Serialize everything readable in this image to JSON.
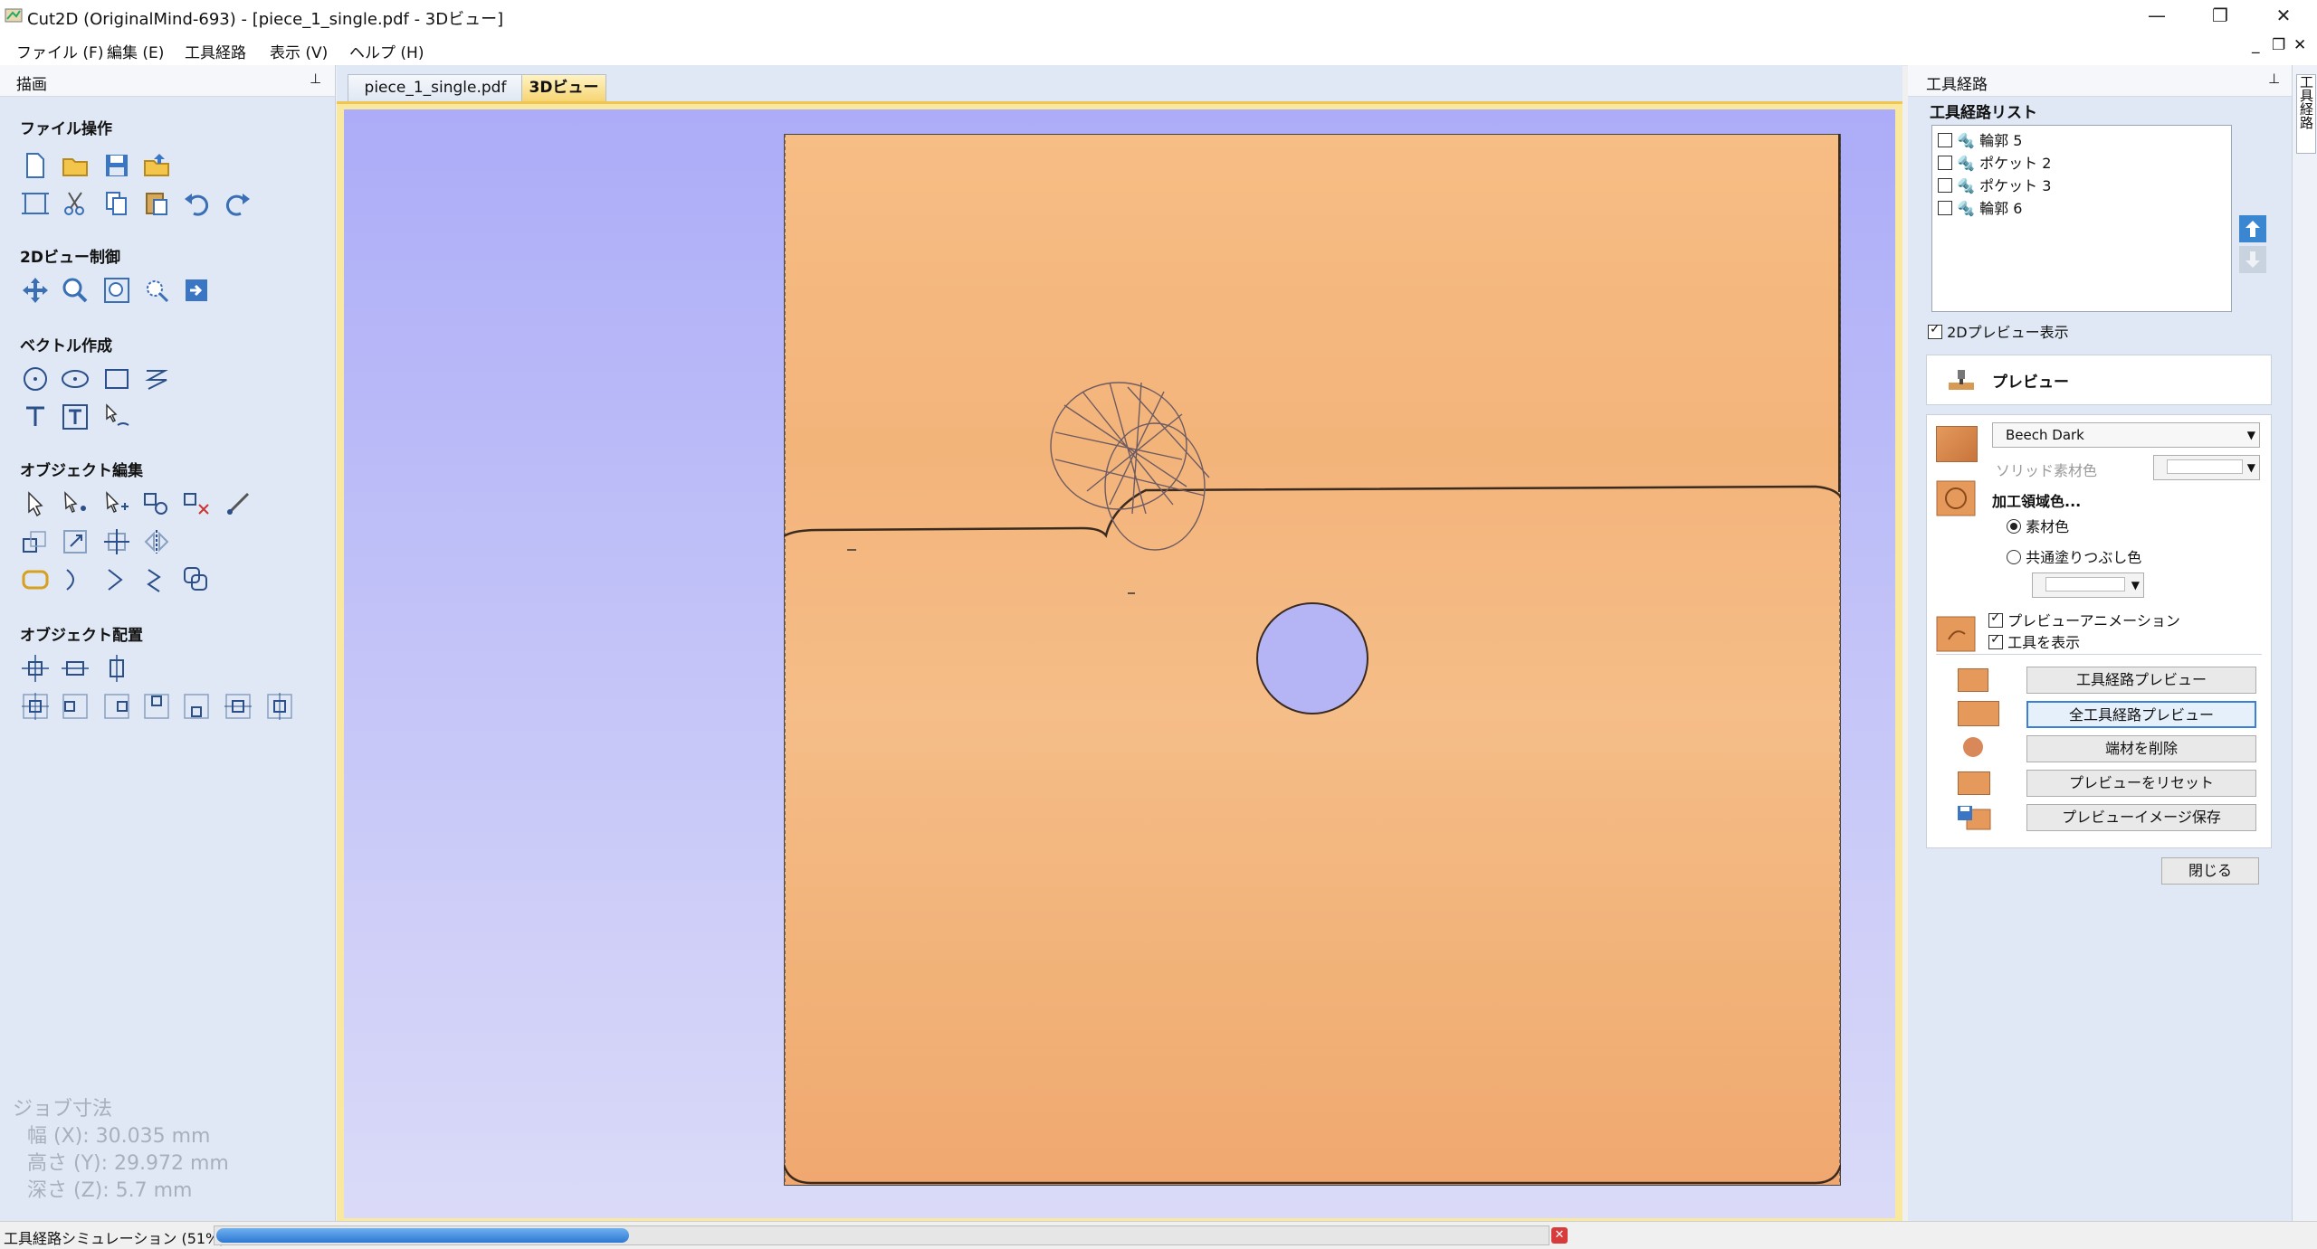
{
  "window": {
    "title": "Cut2D (OriginalMind-693) - [piece_1_single.pdf - 3Dビュー]",
    "min": "—",
    "restore": "❐",
    "close": "✕"
  },
  "menu": [
    "ファイル (F)",
    "編集 (E)",
    "工具経路",
    "表示 (V)",
    "ヘルプ (H)"
  ],
  "mdi": {
    "min": "_",
    "restore": "❐",
    "close": "✕"
  },
  "left": {
    "header": "描画",
    "pin": "📌",
    "sections": {
      "file": "ファイル操作",
      "view2d": "2Dビュー制御",
      "vector": "ベクトル作成",
      "edit": "オブジェクト編集",
      "arrange": "オブジェクト配置"
    },
    "job": {
      "heading": "ジョブ寸法",
      "width": "幅 (X): 30.035 mm",
      "height": "高さ (Y): 29.972 mm",
      "depth": "深さ (Z): 5.7 mm"
    }
  },
  "tabs": [
    {
      "label": "piece_1_single.pdf",
      "active": false
    },
    {
      "label": "3Dビュー",
      "active": true
    }
  ],
  "right": {
    "header": "工具経路",
    "list_title": "工具経路リスト",
    "toolpaths": [
      {
        "name": "輪郭 5",
        "checked": false
      },
      {
        "name": "ポケット 2",
        "checked": false
      },
      {
        "name": "ポケット 3",
        "checked": false
      },
      {
        "name": "輪郭 6",
        "checked": false
      }
    ],
    "show2d": "2Dプレビュー表示",
    "preview_title": "プレビュー",
    "material": "Beech Dark",
    "solid_color_label": "ソリッド素材色",
    "machined_color": "加工領域色...",
    "opt_material": "素材色",
    "opt_common": "共通塗りつぶし色",
    "preview_anim": "プレビューアニメーション",
    "show_tool": "工具を表示",
    "buttons": {
      "tp_preview": "工具経路プレビュー",
      "all_preview": "全工具経路プレビュー",
      "remove_scrap": "端材を削除",
      "reset": "プレビューをリセット",
      "save_image": "プレビューイメージ保存"
    },
    "close": "閉じる",
    "side_tab": "工具経路"
  },
  "status": {
    "text": "工具経路シミュレーション (51%)",
    "progress": 0.31,
    "cancel": "✕"
  },
  "colors": {
    "accent": "#2d78d2",
    "board": "#f3b47a",
    "view_bg": "#b8b8f8"
  }
}
